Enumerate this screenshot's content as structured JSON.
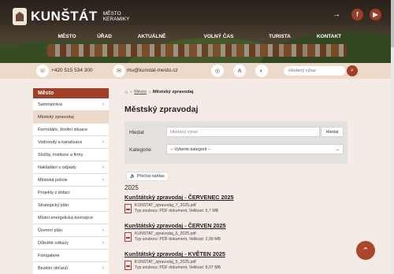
{
  "header": {
    "logo_name": "KUNŠTÁT",
    "logo_sub1": "MĚSTO",
    "logo_sub2": "KERAMIKY",
    "nav": [
      "MĚSTO",
      "ÚŘAD",
      "AKTUÁLNĚ",
      "VOLNÝ ČAS",
      "TURISTA",
      "KONTAKT"
    ],
    "icons": {
      "arrow": "→",
      "facebook": "f",
      "youtube": "▶"
    }
  },
  "contact": {
    "phone": "+420 515 534 300",
    "email": "mu@kunstat-mesto.cz",
    "search_placeholder": "Hledaný výraz"
  },
  "sidebar": {
    "title": "Město",
    "items": [
      {
        "label": "Samospráva",
        "chevron": true
      },
      {
        "label": "Městský zpravodaj",
        "chevron": false,
        "active": true
      },
      {
        "label": "Formuláře, životní situace",
        "chevron": false
      },
      {
        "label": "Vodovody a kanalizace",
        "chevron": true
      },
      {
        "label": "Služby, instituce a firmy",
        "chevron": false
      },
      {
        "label": "Nakládání s odpady",
        "chevron": true
      },
      {
        "label": "Městská policie",
        "chevron": true
      },
      {
        "label": "Projekty z dotací",
        "chevron": false
      },
      {
        "label": "Strategický plán",
        "chevron": false
      },
      {
        "label": "Místní energetická koncepce",
        "chevron": false
      },
      {
        "label": "Územní plán",
        "chevron": true
      },
      {
        "label": "Důležité odkazy",
        "chevron": true
      },
      {
        "label": "Fotogalerie",
        "chevron": false
      },
      {
        "label": "Bezkon občanů",
        "chevron": true
      }
    ]
  },
  "main": {
    "breadcrumb_home": "⌂",
    "breadcrumb_sep": "›",
    "breadcrumb_link": "Město",
    "breadcrumb_current": "Městský zpravodaj",
    "title": "Městský zpravodaj",
    "filter": {
      "search_label": "Hledat",
      "search_placeholder": "Hledaný výraz",
      "search_button": "Hledat",
      "category_label": "Kategorie",
      "category_value": "-- Vyberte kategorii --"
    },
    "listen_label": "Přečíst nahlas",
    "year": "2025",
    "documents": [
      {
        "title": "Kunštátský zpravodaj - ČERVENEC 2025",
        "file": "KUNSTAT_zpravodaj_7_2025.pdf",
        "meta": "Typ souboru: PDF dokument, Velikost: 5,7 MB"
      },
      {
        "title": "Kunštátský zpravodaj - ČERVEN 2025",
        "file": "KUNSTAT_zpravodaj_6_2025.pdf",
        "meta": "Typ souboru: PDF dokument, Velikost: 2,99 MB"
      },
      {
        "title": "Kunštátský zpravodaj - KVĚTEN 2025",
        "file": "KUNSTAT_zpravodaj_5_2025.pdf",
        "meta": "Typ souboru: PDF dokument, Velikost: 8,07 MB"
      }
    ]
  },
  "fab_icon": "⌃"
}
